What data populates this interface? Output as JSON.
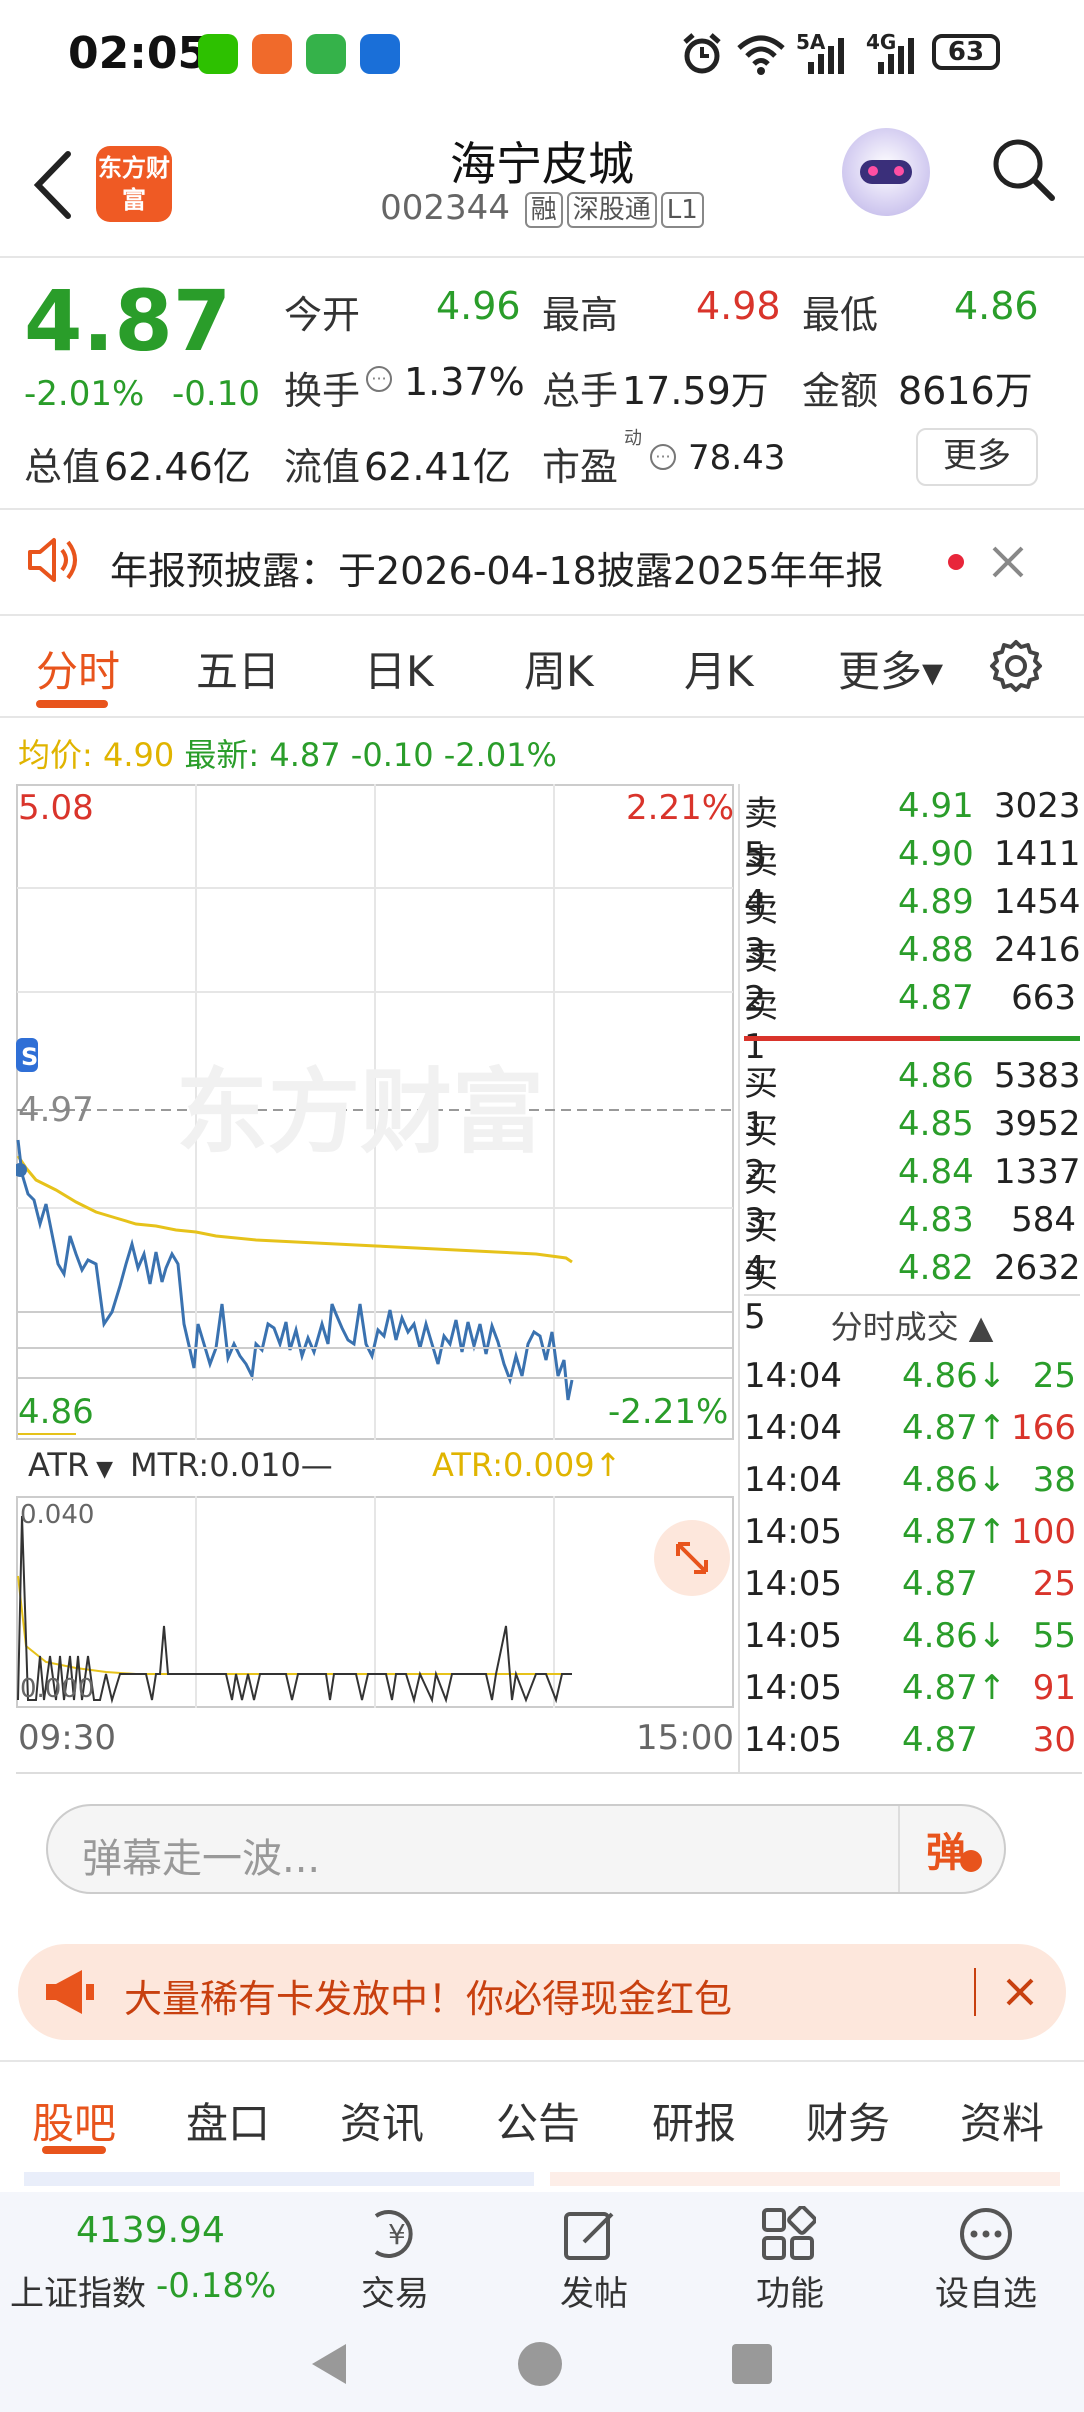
{
  "status_bar": {
    "time": "02:05",
    "battery": "63",
    "net_5g": "5A",
    "net_4g": "4G"
  },
  "header": {
    "logo_text": "东方财富",
    "stock_name": "海宁皮城",
    "stock_code": "002344",
    "tags": [
      "融",
      "深股通",
      "L1"
    ]
  },
  "quote": {
    "price": "4.87",
    "change_pct": "-2.01%",
    "change": "-0.10",
    "open_label": "今开",
    "open": "4.96",
    "high_label": "最高",
    "high": "4.98",
    "low_label": "最低",
    "low": "4.86",
    "turnover_label": "换手",
    "turnover": "1.37%",
    "volume_label": "总手",
    "volume": "17.59万",
    "amount_label": "金额",
    "amount": "8616万",
    "total_mv_label": "总值",
    "total_mv": "62.46亿",
    "float_mv_label": "流值",
    "float_mv": "62.41亿",
    "pe_label": "市盈",
    "pe_sup": "动",
    "pe": "78.43",
    "more_label": "更多"
  },
  "notice": {
    "text": "年报预披露：于2026-04-18披露2025年年报"
  },
  "tabs": [
    "分时",
    "五日",
    "日K",
    "周K",
    "月K",
    "更多▾"
  ],
  "chart_header": {
    "avg_label": "均价:",
    "avg_value": "4.90",
    "latest_label": "最新:",
    "latest_value": "4.87",
    "latest_change": "-0.10",
    "latest_pct": "-2.01%"
  },
  "chart_labels": {
    "top_price": "5.08",
    "top_pct": "2.21%",
    "mid_price": "4.97",
    "bottom_price": "4.86",
    "bottom_pct": "-2.21%",
    "time_start": "09:30",
    "time_end": "15:00",
    "watermark": "东方财富",
    "indicator_select": "ATR",
    "mtr_label": "MTR:0.010—",
    "atr_label": "ATR:0.009↑",
    "ind_top": "0.040",
    "ind_bottom": "0.000"
  },
  "order_book": {
    "asks": [
      {
        "label": "卖5",
        "price": "4.91",
        "vol": "3023"
      },
      {
        "label": "卖4",
        "price": "4.90",
        "vol": "1411"
      },
      {
        "label": "卖3",
        "price": "4.89",
        "vol": "1454"
      },
      {
        "label": "卖2",
        "price": "4.88",
        "vol": "2416"
      },
      {
        "label": "卖1",
        "price": "4.87",
        "vol": "663"
      }
    ],
    "bids": [
      {
        "label": "买1",
        "price": "4.86",
        "vol": "5383"
      },
      {
        "label": "买2",
        "price": "4.85",
        "vol": "3952"
      },
      {
        "label": "买3",
        "price": "4.84",
        "vol": "1337"
      },
      {
        "label": "买4",
        "price": "4.83",
        "vol": "584"
      },
      {
        "label": "买5",
        "price": "4.82",
        "vol": "2632"
      }
    ]
  },
  "trades": {
    "title": "分时成交 ▲",
    "rows": [
      {
        "time": "14:04",
        "price": "4.86↓",
        "vol": "25",
        "dir": "down"
      },
      {
        "time": "14:04",
        "price": "4.87↑",
        "vol": "166",
        "dir": "up"
      },
      {
        "time": "14:04",
        "price": "4.86↓",
        "vol": "38",
        "dir": "down"
      },
      {
        "time": "14:05",
        "price": "4.87↑",
        "vol": "100",
        "dir": "up"
      },
      {
        "time": "14:05",
        "price": "4.87",
        "vol": "25",
        "dir": "flat"
      },
      {
        "time": "14:05",
        "price": "4.86↓",
        "vol": "55",
        "dir": "down"
      },
      {
        "time": "14:05",
        "price": "4.87↑",
        "vol": "91",
        "dir": "up"
      },
      {
        "time": "14:05",
        "price": "4.87",
        "vol": "30",
        "dir": "flat"
      }
    ]
  },
  "danmu": {
    "placeholder": "弹幕走一波...",
    "button": "弹"
  },
  "promo": {
    "text": "大量稀有卡发放中！你必得现金红包"
  },
  "bottom_tabs": [
    "股吧",
    "盘口",
    "资讯",
    "公告",
    "研报",
    "财务",
    "资料"
  ],
  "bottom_nav": {
    "index_value": "4139.94",
    "index_name": "上证指数",
    "index_pct": "-0.18%",
    "items": [
      "交易",
      "发帖",
      "功能",
      "设自选"
    ]
  },
  "colors": {
    "accent": "#e8541c",
    "up": "#d9342b",
    "down": "#2a9d2a",
    "price_line": "#3a72b0",
    "avg_line": "#e6c21a"
  }
}
